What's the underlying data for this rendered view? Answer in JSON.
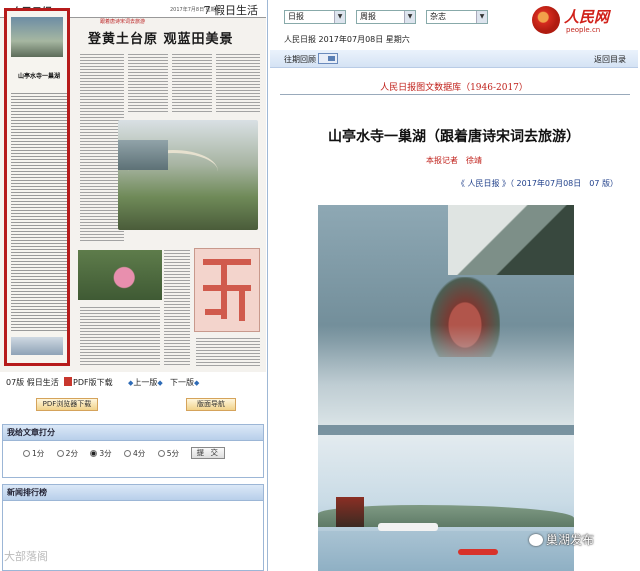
{
  "newspaper_page": {
    "masthead": "人民日报",
    "page_label": "7 假日生活",
    "date_line": "2017年7月8日 星期六",
    "kicker": "跟着唐诗宋词去旅游",
    "spread_title": "登黄土台原 观蓝田美景",
    "selected_headline": "山亭水寺一巢湖"
  },
  "paper_nav": {
    "page_name": "07版 假日生活",
    "pdf_download": "PDF版下载",
    "prev_page": "上一版",
    "next_page": "下一版"
  },
  "buttons": {
    "pdf_browser_download": "PDF浏览器下载",
    "layout_navigation": "版面导航"
  },
  "rating_panel": {
    "title": "我给文章打分",
    "options": [
      "1分",
      "2分",
      "3分",
      "4分",
      "5分"
    ],
    "selected_index": 2,
    "submit_label": "提 交"
  },
  "ranking_panel": {
    "title": "新闻排行榜"
  },
  "watermark_left": "大部落阁",
  "top_selects": {
    "daily": "日报",
    "weekly": "周报",
    "magazine": "杂志"
  },
  "logo": {
    "brand": "人民网",
    "url": "people.cn",
    "accent_color": "#d1211a"
  },
  "issue_info": "人民日报 2017年07月08日 星期六",
  "toolbar": {
    "back_label": "往期回顾",
    "toc_link": "返回目录"
  },
  "database_title": "人民日报图文数据库（1946-2017）",
  "article": {
    "title": "山亭水寺一巢湖（跟着唐诗宋词去旅游）",
    "byline": "本报记者　徐靖",
    "source_line": "《 人民日报 》（ 2017年07月08日　07 版）"
  },
  "watermark_right": "巢湖发布"
}
